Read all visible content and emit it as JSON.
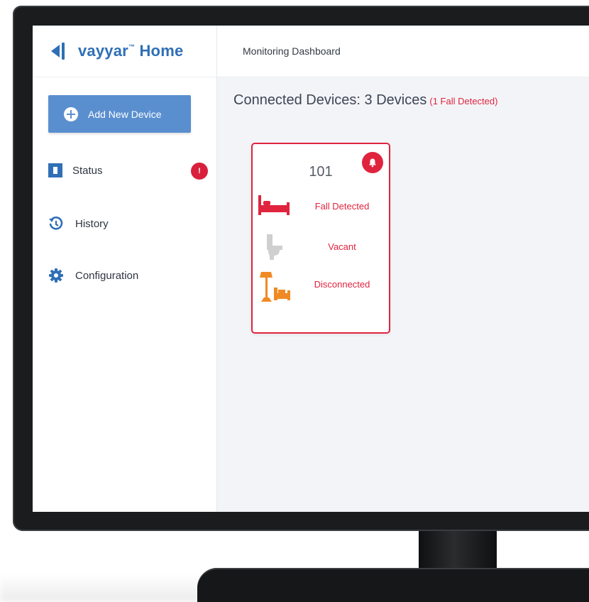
{
  "app": {
    "logo_text": "vayyar",
    "logo_tm": "™",
    "logo_suffix": "Home",
    "brand_color": "#2f6fb6"
  },
  "header": {
    "title": "Monitoring Dashboard"
  },
  "sidebar": {
    "add_button_label": "Add New Device",
    "items": [
      {
        "label": "Status",
        "icon": "status-icon",
        "badge": "!"
      },
      {
        "label": "History",
        "icon": "history-icon"
      },
      {
        "label": "Configuration",
        "icon": "gear-icon"
      }
    ]
  },
  "main": {
    "heading": "Connected Devices: 3 Devices",
    "alert_text": "(1 Fall Detected)",
    "alert_color": "#e0243e",
    "devices": [
      {
        "number": "101",
        "alert_icon": "bell-icon",
        "rooms": [
          {
            "icon": "bed-icon",
            "status": "Fall Detected",
            "color": "#e0243e"
          },
          {
            "icon": "toilet-icon",
            "status": "Vacant",
            "color": "#c8c8c8"
          },
          {
            "icon": "living-room-icon",
            "status": "Disconnected",
            "color": "#f08a24"
          }
        ]
      }
    ]
  }
}
